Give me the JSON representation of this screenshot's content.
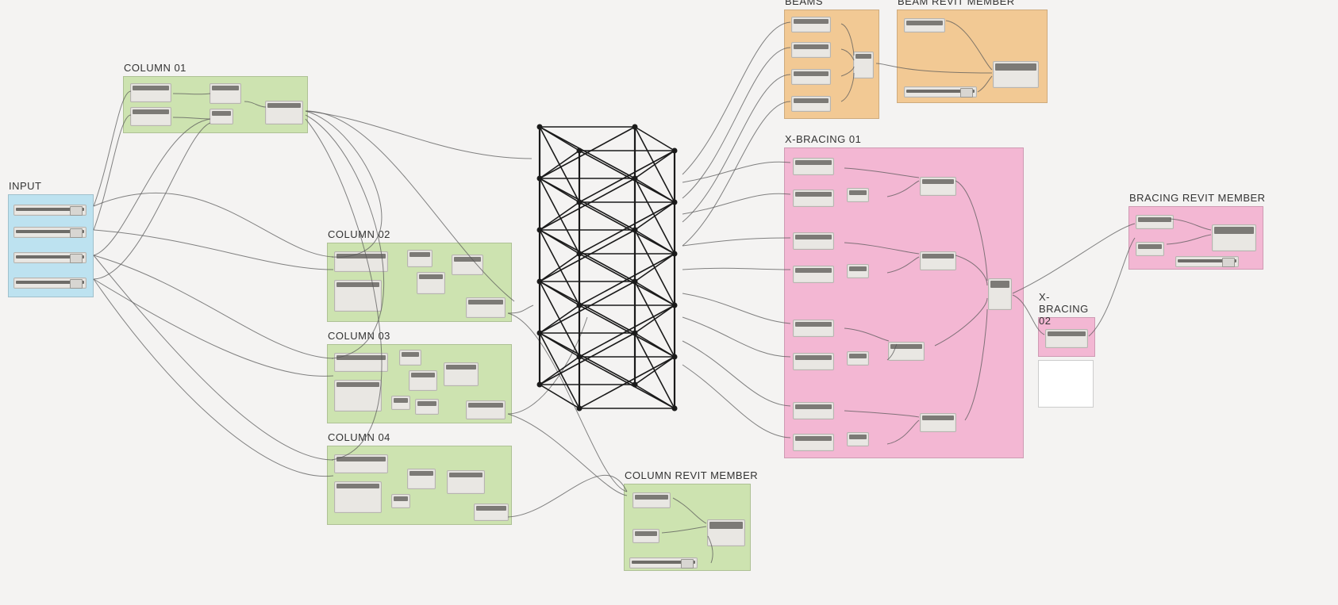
{
  "groups": {
    "input": {
      "label": "INPUT"
    },
    "col1": {
      "label": "COLUMN 01"
    },
    "col2": {
      "label": "COLUMN 02"
    },
    "col3": {
      "label": "COLUMN 03"
    },
    "col4": {
      "label": "COLUMN 04"
    },
    "beams": {
      "label": "BEAMS"
    },
    "beam_member": {
      "label": "BEAM REVIT MEMBER"
    },
    "xb1": {
      "label": "X-BRACING 01"
    },
    "xb2": {
      "label": "X-BRACING 02"
    },
    "col_member": {
      "label": "COLUMN REVIT MEMBER"
    },
    "brace_member": {
      "label": "BRACING REVIT MEMBER"
    }
  },
  "tower": {
    "floors": 6,
    "width_front": 120,
    "depth": 60,
    "floor_height": 65
  }
}
